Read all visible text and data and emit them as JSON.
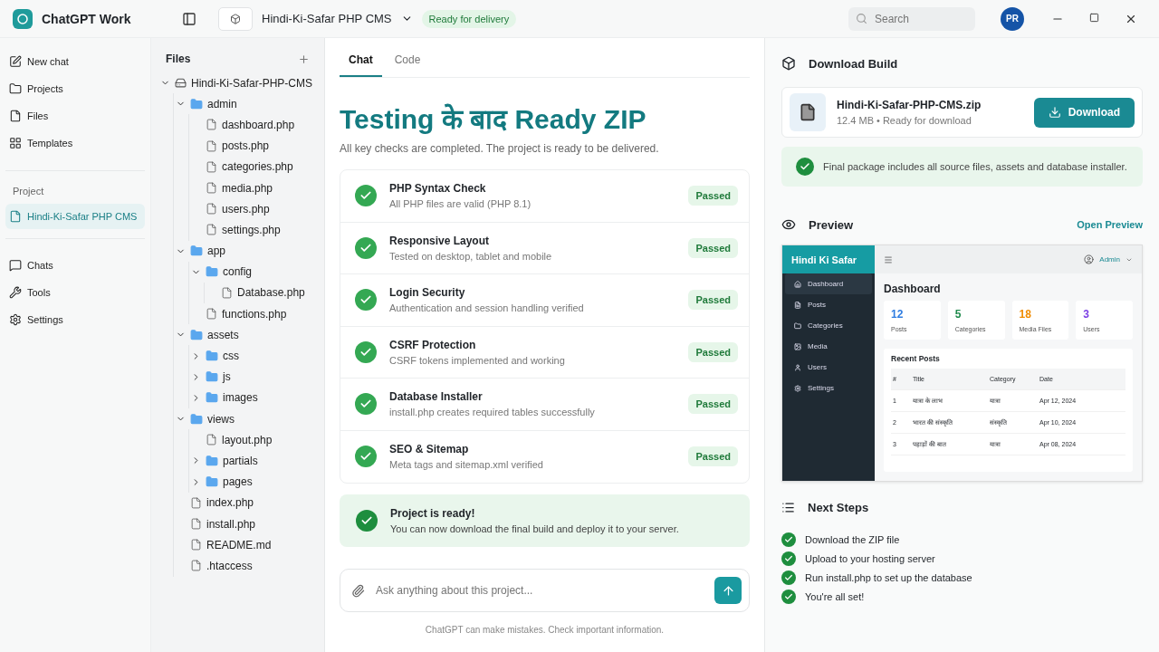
{
  "app": {
    "title": "ChatGPT Work"
  },
  "project_header": {
    "name": "Hindi-Ki-Safar PHP CMS",
    "status": "Ready for delivery"
  },
  "search": {
    "placeholder": "Search"
  },
  "user": {
    "initials": "PR"
  },
  "sidebar": {
    "items": [
      {
        "label": "New chat",
        "selected": false
      },
      {
        "label": "Projects",
        "selected": false
      },
      {
        "label": "Files",
        "selected": false
      },
      {
        "label": "Templates",
        "selected": false
      }
    ],
    "section_label": "Project",
    "project_items": [
      {
        "label": "Hindi-Ki-Safar PHP CMS",
        "selected": true
      }
    ],
    "bottom_items": [
      {
        "label": "Chats",
        "selected": false
      },
      {
        "label": "Tools",
        "selected": false
      },
      {
        "label": "Settings",
        "selected": false
      }
    ]
  },
  "files": {
    "title": "Files",
    "tree": [
      {
        "name": "Hindi-Ki-Safar-PHP-CMS",
        "kind": "root",
        "expanded": true,
        "children": [
          {
            "name": "admin",
            "kind": "folder",
            "expanded": true,
            "children": [
              {
                "name": "dashboard.php",
                "kind": "file"
              },
              {
                "name": "posts.php",
                "kind": "file"
              },
              {
                "name": "categories.php",
                "kind": "file"
              },
              {
                "name": "media.php",
                "kind": "file"
              },
              {
                "name": "users.php",
                "kind": "file"
              },
              {
                "name": "settings.php",
                "kind": "file"
              }
            ]
          },
          {
            "name": "app",
            "kind": "folder",
            "expanded": true,
            "children": [
              {
                "name": "config",
                "kind": "folder",
                "expanded": true,
                "children": [
                  {
                    "name": "Database.php",
                    "kind": "file"
                  }
                ]
              },
              {
                "name": "functions.php",
                "kind": "file"
              }
            ]
          },
          {
            "name": "assets",
            "kind": "folder",
            "expanded": true,
            "children": [
              {
                "name": "css",
                "kind": "folder",
                "expanded": false
              },
              {
                "name": "js",
                "kind": "folder",
                "expanded": false
              },
              {
                "name": "images",
                "kind": "folder",
                "expanded": false
              }
            ]
          },
          {
            "name": "views",
            "kind": "folder",
            "expanded": true,
            "children": [
              {
                "name": "layout.php",
                "kind": "file"
              },
              {
                "name": "partials",
                "kind": "folder",
                "expanded": false
              },
              {
                "name": "pages",
                "kind": "folder",
                "expanded": false
              }
            ]
          },
          {
            "name": "index.php",
            "kind": "file"
          },
          {
            "name": "install.php",
            "kind": "file"
          },
          {
            "name": "README.md",
            "kind": "file"
          },
          {
            "name": ".htaccess",
            "kind": "file"
          }
        ]
      }
    ]
  },
  "chat": {
    "tabs": [
      {
        "label": "Chat",
        "selected": true
      },
      {
        "label": "Code",
        "selected": false
      }
    ],
    "heading": "Testing के बाद Ready ZIP",
    "subtitle": "All key checks are completed. The project is ready to be delivered.",
    "checks": [
      {
        "title": "PHP Syntax Check",
        "detail": "All PHP files are valid (PHP 8.1)",
        "status": "Passed"
      },
      {
        "title": "Responsive Layout",
        "detail": "Tested on desktop, tablet and mobile",
        "status": "Passed"
      },
      {
        "title": "Login Security",
        "detail": "Authentication and session handling verified",
        "status": "Passed"
      },
      {
        "title": "CSRF Protection",
        "detail": "CSRF tokens implemented and working",
        "status": "Passed"
      },
      {
        "title": "Database Installer",
        "detail": "install.php creates required tables successfully",
        "status": "Passed"
      },
      {
        "title": "SEO & Sitemap",
        "detail": "Meta tags and sitemap.xml verified",
        "status": "Passed"
      }
    ],
    "ready": {
      "title": "Project is ready!",
      "text": "You can now download the final build and deploy it to your server."
    },
    "composer": {
      "placeholder": "Ask anything about this project..."
    },
    "disclaimer": "ChatGPT can make mistakes. Check important information."
  },
  "download": {
    "title": "Download Build",
    "file_name": "Hindi-Ki-Safar-PHP-CMS.zip",
    "file_meta": "12.4 MB • Ready for download",
    "button": "Download",
    "note": "Final package includes all source files, assets and database installer."
  },
  "preview": {
    "title": "Preview",
    "link": "Open Preview",
    "mock": {
      "brand": "Hindi Ki Safar",
      "user": "Admin",
      "nav": [
        {
          "label": "Dashboard",
          "selected": true
        },
        {
          "label": "Posts",
          "selected": false
        },
        {
          "label": "Categories",
          "selected": false
        },
        {
          "label": "Media",
          "selected": false
        },
        {
          "label": "Users",
          "selected": false
        },
        {
          "label": "Settings",
          "selected": false
        }
      ],
      "page_title": "Dashboard",
      "stats": [
        {
          "value": "12",
          "label": "Posts",
          "color": "#2f7de1"
        },
        {
          "value": "5",
          "label": "Categories",
          "color": "#1f8a4c"
        },
        {
          "value": "18",
          "label": "Media Files",
          "color": "#f08c00"
        },
        {
          "value": "3",
          "label": "Users",
          "color": "#7b3fe4"
        }
      ],
      "table_title": "Recent Posts",
      "columns": [
        "#",
        "Title",
        "Category",
        "Date"
      ],
      "rows": [
        [
          "1",
          "यात्रा के लाभ",
          "यात्रा",
          "Apr 12, 2024"
        ],
        [
          "2",
          "भारत की संस्कृति",
          "संस्कृति",
          "Apr 10, 2024"
        ],
        [
          "3",
          "पहाड़ों की बात",
          "यात्रा",
          "Apr 08, 2024"
        ]
      ]
    }
  },
  "next_steps": {
    "title": "Next Steps",
    "items": [
      {
        "label": "Download the ZIP file",
        "done": true
      },
      {
        "label": "Upload to your hosting server",
        "done": true
      },
      {
        "label": "Run install.php to set up the database",
        "done": true
      },
      {
        "label": "You're all set!",
        "done": true
      }
    ]
  }
}
